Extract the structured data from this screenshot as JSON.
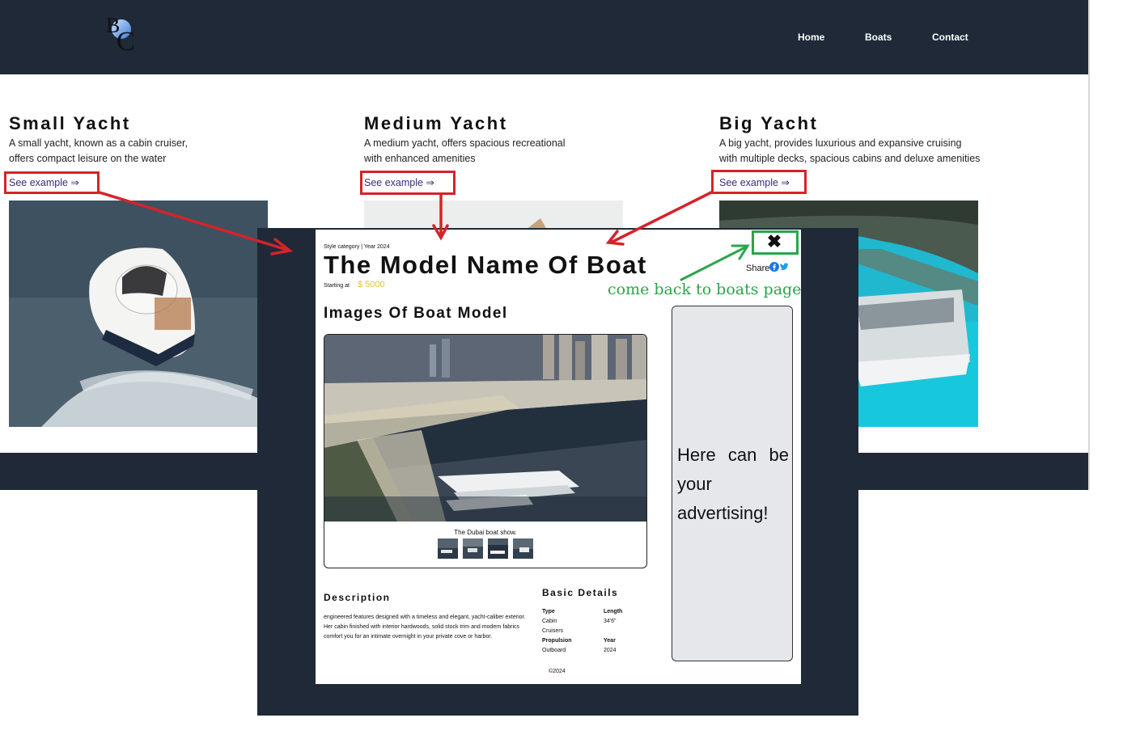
{
  "header": {
    "logo_letters": "BC",
    "nav": [
      "Home",
      "Boats",
      "Contact"
    ]
  },
  "cards": [
    {
      "title": "Small Yacht",
      "desc_line1": "A small yacht, known as a cabin cruiser,",
      "desc_line2": "offers compact leisure on the water",
      "link": "See example ⇒"
    },
    {
      "title": "Medium Yacht",
      "desc_line1": "A medium yacht, offers spacious recreational",
      "desc_line2": "with enhanced amenities",
      "link": "See example ⇒"
    },
    {
      "title": "Big Yacht",
      "desc_line1": "A big yacht, provides luxurious and expansive cruising",
      "desc_line2": "with multiple decks, spacious cabins and deluxe amenities",
      "link": "See example ⇒"
    }
  ],
  "modal": {
    "meta": "Style category   |  Year 2024",
    "title": "The Model Name Of Boat",
    "starting_label": "Starting at",
    "price": "$ 5000",
    "share_label": "Share",
    "close_symbol": "✖",
    "images_title": "Images Of Boat Model",
    "caption": "The Dubai boat show.",
    "ad_text": "Here can be your advertising!",
    "description_title": "Description",
    "description_text": "engineered features designed with a timeless and elegant, yacht-caliber exterior. Her cabin finished with interior hardwoods, solid stock trim and modern fabrics comfort you for an intimate overnight in your private cove or harbor.",
    "basic_details_title": "Basic Details",
    "details": {
      "type_label": "Type",
      "type_value_1": "Cabin",
      "type_value_2": "Cruisers",
      "length_label": "Length",
      "length_value": "34'6\"",
      "propulsion_label": "Propulsion",
      "propulsion_value": "Outboard",
      "year_label": "Year",
      "year_value": "2024"
    },
    "copyright": "©2024"
  },
  "annotation": {
    "note": "come back to boats page",
    "red_color": "#d5232a",
    "green_color": "#2aa54a"
  },
  "colors": {
    "navbar": "#1f2937",
    "price": "#e3c23a",
    "link": "#3b2b7a",
    "ad_bg": "#e5e7eb"
  }
}
